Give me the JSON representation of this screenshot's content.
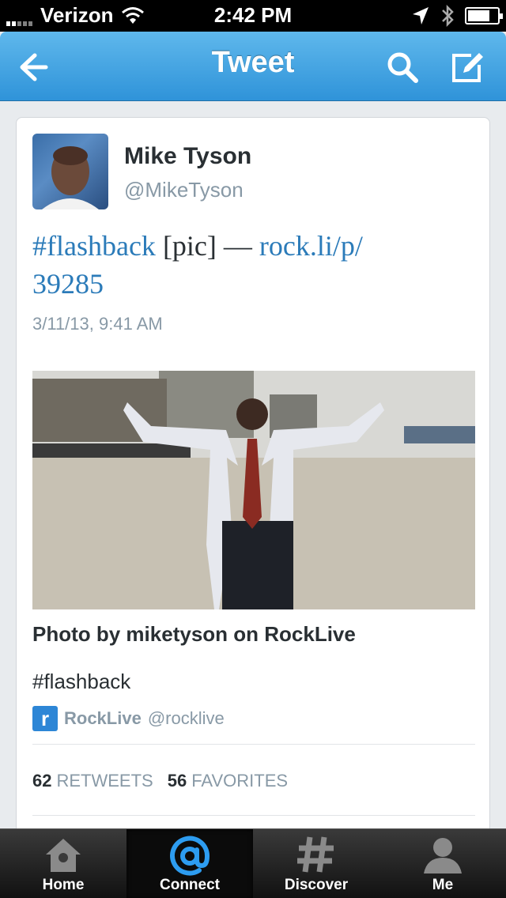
{
  "status_bar": {
    "carrier": "Verizon",
    "time": "2:42 PM",
    "battery_level": 0.75
  },
  "nav": {
    "title": "Tweet",
    "back_icon": "back-arrow-icon",
    "search_icon": "search-icon",
    "compose_icon": "compose-icon"
  },
  "tweet": {
    "display_name": "Mike Tyson",
    "handle": "@MikeTyson",
    "hashtag": "#flashback",
    "text_middle": " [pic] — ",
    "link_line1": "rock.li/p/",
    "link_line2": "39285",
    "timestamp": "3/11/13, 9:41 AM"
  },
  "media_card": {
    "title": "Photo by miketyson on RockLive",
    "description": "#flashback",
    "source_logo": "r",
    "source_name": "RockLive",
    "source_handle": "@rocklive"
  },
  "stats": {
    "retweets_count": "62",
    "retweets_label": "RETWEETS",
    "favorites_count": "56",
    "favorites_label": "FAVORITES"
  },
  "tabs": [
    {
      "label": "Home",
      "icon": "home-icon"
    },
    {
      "label": "Connect",
      "icon": "at-icon"
    },
    {
      "label": "Discover",
      "icon": "hash-icon"
    },
    {
      "label": "Me",
      "icon": "person-icon"
    }
  ],
  "colors": {
    "nav_blue": "#2f93d9",
    "link_blue": "#2b7bb9",
    "connect_blue": "#2d9cf0"
  }
}
